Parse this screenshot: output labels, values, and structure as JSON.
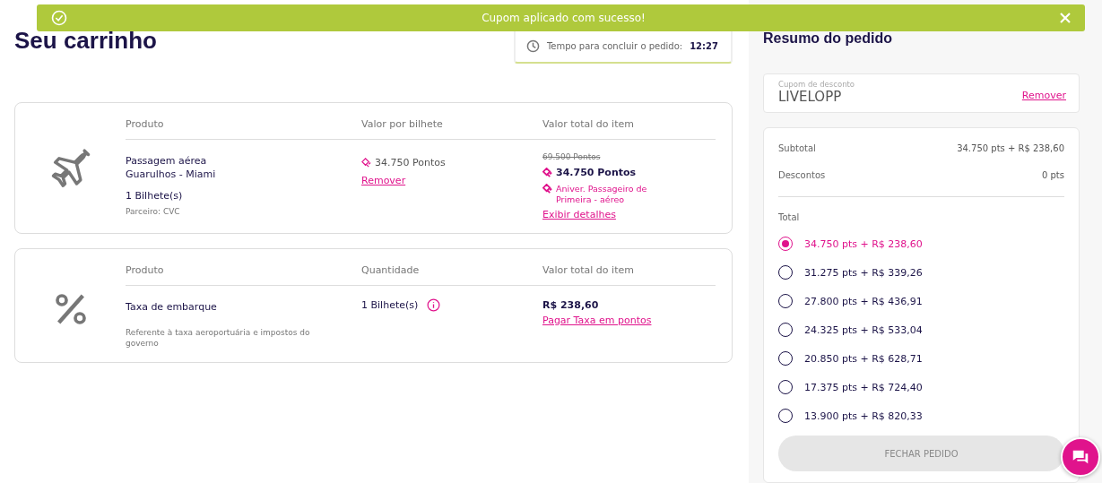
{
  "toast": {
    "message": "Cupom aplicado com sucesso!"
  },
  "title": "Seu carrinho",
  "timer": {
    "label": "Tempo para concluir o pedido:",
    "value": "12:27"
  },
  "items": [
    {
      "kind": "flight",
      "columns": [
        "Produto",
        "Valor por bilhete",
        "Valor total do item"
      ],
      "name": [
        "Passagem aérea",
        "Guarulhos - Miami"
      ],
      "quantity": "1 Bilhete(s)",
      "note": "Parceiro: CVC",
      "unit_price": "34.750 Pontos",
      "unit_link": "Remover",
      "old_total": "69.500 Pontos",
      "total": "34.750 Pontos",
      "promo": "Aniver. Passageiro de Primeira - aéreo",
      "total_link": "Exibir detalhes"
    },
    {
      "kind": "fee",
      "columns": [
        "Produto",
        "Quantidade",
        "Valor total do item"
      ],
      "name": [
        "Taxa de embarque"
      ],
      "note": "Referente à taxa aeroportuária e impostos do governo",
      "quantity": "1 Bilhete(s)",
      "total": "R$ 238,60",
      "total_link": "Pagar Taxa em pontos"
    }
  ],
  "summary": {
    "title": "Resumo do pedido",
    "coupon": {
      "label": "Cupom de desconto",
      "value": "LIVELOPP",
      "action": "Remover"
    },
    "lines": [
      {
        "label": "Subtotal",
        "value": "34.750 pts + R$ 238,60"
      },
      {
        "label": "Descontos",
        "value": "0 pts"
      }
    ],
    "total_label": "Total",
    "options": [
      {
        "label": "34.750 pts + R$ 238,60",
        "selected": true
      },
      {
        "label": "31.275 pts + R$ 339,26",
        "selected": false
      },
      {
        "label": "27.800 pts + R$ 436,91",
        "selected": false
      },
      {
        "label": "24.325 pts + R$ 533,04",
        "selected": false
      },
      {
        "label": "20.850 pts + R$ 628,71",
        "selected": false
      },
      {
        "label": "17.375 pts + R$ 724,40",
        "selected": false
      },
      {
        "label": "13.900 pts + R$ 820,33",
        "selected": false
      }
    ],
    "button": {
      "label": "FECHAR PEDIDO",
      "disabled": true
    }
  }
}
